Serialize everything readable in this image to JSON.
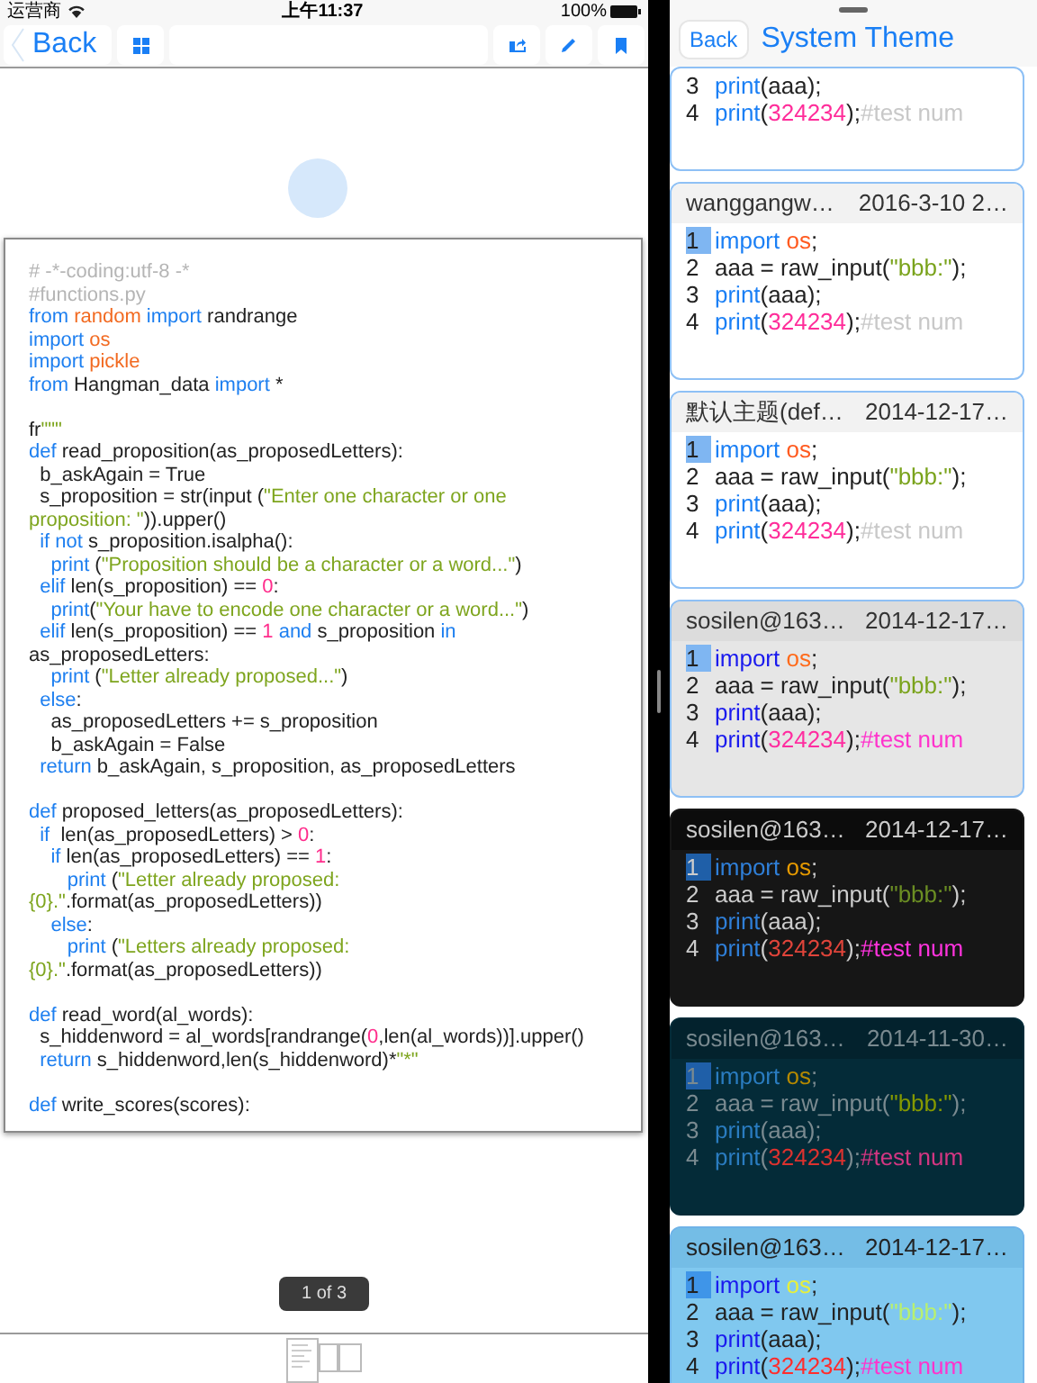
{
  "status_bar": {
    "carrier": "运营商",
    "time": "上午11:37",
    "battery": "100%"
  },
  "toolbar": {
    "back": "Back"
  },
  "document": {
    "page_indicator": "1 of 3",
    "lines": [
      {
        "kind": "code",
        "tokens": [
          {
            "kind": "comment",
            "text": "# -*-coding:utf-8 -*"
          }
        ]
      },
      {
        "kind": "code",
        "tokens": [
          {
            "kind": "comment",
            "text": "#functions.py"
          }
        ]
      },
      {
        "kind": "code",
        "tokens": [
          {
            "kind": "kw",
            "text": "from "
          },
          {
            "kind": "mod",
            "text": "random"
          },
          {
            "kind": "kw",
            "text": " import"
          },
          {
            "kind": "plain",
            "text": " randrange"
          }
        ]
      },
      {
        "kind": "code",
        "tokens": [
          {
            "kind": "kw",
            "text": "import "
          },
          {
            "kind": "mod",
            "text": "os"
          }
        ]
      },
      {
        "kind": "code",
        "tokens": [
          {
            "kind": "kw",
            "text": "import "
          },
          {
            "kind": "mod",
            "text": "pickle"
          }
        ]
      },
      {
        "kind": "code",
        "tokens": [
          {
            "kind": "kw",
            "text": "from"
          },
          {
            "kind": "plain",
            "text": " Hangman_data "
          },
          {
            "kind": "kw",
            "text": "import"
          },
          {
            "kind": "plain",
            "text": " *"
          }
        ]
      },
      {
        "kind": "blank"
      },
      {
        "kind": "code",
        "tokens": [
          {
            "kind": "plain",
            "text": "fr"
          },
          {
            "kind": "str",
            "text": "\"\"\""
          }
        ]
      },
      {
        "kind": "code",
        "tokens": [
          {
            "kind": "kw",
            "text": "def"
          },
          {
            "kind": "plain",
            "text": " read_proposition(as_proposedLetters):"
          }
        ]
      },
      {
        "kind": "code",
        "tokens": [
          {
            "kind": "plain",
            "text": "  b_askAgain = True"
          }
        ]
      },
      {
        "kind": "code",
        "tokens": [
          {
            "kind": "plain",
            "text": "  s_proposition = str(input ("
          },
          {
            "kind": "str",
            "text": "\"Enter one character or one"
          }
        ]
      },
      {
        "kind": "code",
        "tokens": [
          {
            "kind": "str",
            "text": "proposition: \""
          },
          {
            "kind": "plain",
            "text": ")).upper()"
          }
        ]
      },
      {
        "kind": "code",
        "tokens": [
          {
            "kind": "kw",
            "text": "  if not"
          },
          {
            "kind": "plain",
            "text": " s_proposition.isalpha():"
          }
        ]
      },
      {
        "kind": "code",
        "tokens": [
          {
            "kind": "kw",
            "text": "    print"
          },
          {
            "kind": "plain",
            "text": " ("
          },
          {
            "kind": "str",
            "text": "\"Proposition should be a character or a word...\""
          },
          {
            "kind": "plain",
            "text": ")"
          }
        ]
      },
      {
        "kind": "code",
        "tokens": [
          {
            "kind": "kw",
            "text": "  elif"
          },
          {
            "kind": "plain",
            "text": " len(s_proposition) == "
          },
          {
            "kind": "num",
            "text": "0"
          },
          {
            "kind": "plain",
            "text": ":"
          }
        ]
      },
      {
        "kind": "code",
        "tokens": [
          {
            "kind": "kw",
            "text": "    print"
          },
          {
            "kind": "plain",
            "text": "("
          },
          {
            "kind": "str",
            "text": "\"Your have to encode one character or a word...\""
          },
          {
            "kind": "plain",
            "text": ")"
          }
        ]
      },
      {
        "kind": "code",
        "tokens": [
          {
            "kind": "kw",
            "text": "  elif"
          },
          {
            "kind": "plain",
            "text": " len(s_proposition) == "
          },
          {
            "kind": "num",
            "text": "1"
          },
          {
            "kind": "kw",
            "text": " and"
          },
          {
            "kind": "plain",
            "text": " s_proposition "
          },
          {
            "kind": "kw",
            "text": "in"
          }
        ]
      },
      {
        "kind": "code",
        "tokens": [
          {
            "kind": "plain",
            "text": "as_proposedLetters:"
          }
        ]
      },
      {
        "kind": "code",
        "tokens": [
          {
            "kind": "kw",
            "text": "    print"
          },
          {
            "kind": "plain",
            "text": " ("
          },
          {
            "kind": "str",
            "text": "\"Letter already proposed...\""
          },
          {
            "kind": "plain",
            "text": ")"
          }
        ]
      },
      {
        "kind": "code",
        "tokens": [
          {
            "kind": "kw",
            "text": "  else"
          },
          {
            "kind": "plain",
            "text": ":"
          }
        ]
      },
      {
        "kind": "code",
        "tokens": [
          {
            "kind": "plain",
            "text": "    as_proposedLetters += s_proposition"
          }
        ]
      },
      {
        "kind": "code",
        "tokens": [
          {
            "kind": "plain",
            "text": "    b_askAgain = False"
          }
        ]
      },
      {
        "kind": "code",
        "tokens": [
          {
            "kind": "kw",
            "text": "  return"
          },
          {
            "kind": "plain",
            "text": " b_askAgain, s_proposition, as_proposedLetters"
          }
        ]
      },
      {
        "kind": "blank"
      },
      {
        "kind": "code",
        "tokens": [
          {
            "kind": "kw",
            "text": "def"
          },
          {
            "kind": "plain",
            "text": " proposed_letters(as_proposedLetters):"
          }
        ]
      },
      {
        "kind": "code",
        "tokens": [
          {
            "kind": "kw",
            "text": "  if"
          },
          {
            "kind": "plain",
            "text": "  len(as_proposedLetters) > "
          },
          {
            "kind": "num",
            "text": "0"
          },
          {
            "kind": "plain",
            "text": ":"
          }
        ]
      },
      {
        "kind": "code",
        "tokens": [
          {
            "kind": "kw",
            "text": "    if"
          },
          {
            "kind": "plain",
            "text": " len(as_proposedLetters) == "
          },
          {
            "kind": "num",
            "text": "1"
          },
          {
            "kind": "plain",
            "text": ":"
          }
        ]
      },
      {
        "kind": "code",
        "tokens": [
          {
            "kind": "kw",
            "text": "       print"
          },
          {
            "kind": "plain",
            "text": " ("
          },
          {
            "kind": "str",
            "text": "\"Letter already proposed:"
          }
        ]
      },
      {
        "kind": "code",
        "tokens": [
          {
            "kind": "str",
            "text": "{0}.\""
          },
          {
            "kind": "plain",
            "text": ".format(as_proposedLetters))"
          }
        ]
      },
      {
        "kind": "code",
        "tokens": [
          {
            "kind": "kw",
            "text": "    else"
          },
          {
            "kind": "plain",
            "text": ":"
          }
        ]
      },
      {
        "kind": "code",
        "tokens": [
          {
            "kind": "kw",
            "text": "       print"
          },
          {
            "kind": "plain",
            "text": " ("
          },
          {
            "kind": "str",
            "text": "\"Letters already proposed:"
          }
        ]
      },
      {
        "kind": "code",
        "tokens": [
          {
            "kind": "str",
            "text": "{0}.\""
          },
          {
            "kind": "plain",
            "text": ".format(as_proposedLetters))"
          }
        ]
      },
      {
        "kind": "blank"
      },
      {
        "kind": "code",
        "tokens": [
          {
            "kind": "kw",
            "text": "def"
          },
          {
            "kind": "plain",
            "text": " read_word(al_words):"
          }
        ]
      },
      {
        "kind": "code",
        "tokens": [
          {
            "kind": "plain",
            "text": "  s_hiddenword = al_words[randrange("
          },
          {
            "kind": "num",
            "text": "0"
          },
          {
            "kind": "plain",
            "text": ",len(al_words))].upper()"
          }
        ]
      },
      {
        "kind": "code",
        "tokens": [
          {
            "kind": "kw",
            "text": "  return"
          },
          {
            "kind": "plain",
            "text": " s_hiddenword,len(s_hiddenword)*"
          },
          {
            "kind": "str",
            "text": "\"*\""
          }
        ]
      },
      {
        "kind": "blank"
      },
      {
        "kind": "code",
        "tokens": [
          {
            "kind": "kw",
            "text": "def"
          },
          {
            "kind": "plain",
            "text": " write_scores(scores):"
          }
        ]
      }
    ]
  },
  "theme_panel": {
    "back": "Back",
    "title": "System Theme",
    "themes": [
      {
        "kind": "light",
        "lines": [
          {
            "number": "3",
            "selected": false,
            "tokens": [
              {
                "kind": "kw",
                "text": "print"
              },
              {
                "kind": "plain",
                "text": "(aaa);"
              }
            ]
          },
          {
            "number": "4",
            "selected": false,
            "tokens": [
              {
                "kind": "kw",
                "text": "print"
              },
              {
                "kind": "plain",
                "text": "("
              },
              {
                "kind": "num",
                "text": "324234"
              },
              {
                "kind": "plain",
                "text": ");"
              },
              {
                "kind": "comment",
                "text": "#test num"
              }
            ]
          }
        ]
      },
      {
        "kind": "light",
        "name": "wanggangw…",
        "date": "2016-3-10 2…",
        "lines": [
          {
            "number": "1",
            "selected": true,
            "tokens": [
              {
                "kind": "kw",
                "text": "import "
              },
              {
                "kind": "mod",
                "text": "os"
              },
              {
                "kind": "plain",
                "text": ";"
              }
            ]
          },
          {
            "number": "2",
            "selected": false,
            "tokens": [
              {
                "kind": "plain",
                "text": "aaa = raw_input("
              },
              {
                "kind": "str",
                "text": "\"bbb:\""
              },
              {
                "kind": "plain",
                "text": ");"
              }
            ]
          },
          {
            "number": "3",
            "selected": false,
            "tokens": [
              {
                "kind": "kw",
                "text": "print"
              },
              {
                "kind": "plain",
                "text": "(aaa);"
              }
            ]
          },
          {
            "number": "4",
            "selected": false,
            "tokens": [
              {
                "kind": "kw",
                "text": "print"
              },
              {
                "kind": "plain",
                "text": "("
              },
              {
                "kind": "num",
                "text": "324234"
              },
              {
                "kind": "plain",
                "text": ");"
              },
              {
                "kind": "comment",
                "text": "#test num"
              }
            ]
          }
        ]
      },
      {
        "kind": "light",
        "name": "默认主题(def…",
        "date": "2014-12-17…",
        "lines": [
          {
            "number": "1",
            "selected": true,
            "tokens": [
              {
                "kind": "kw",
                "text": "import "
              },
              {
                "kind": "mod",
                "text": "os"
              },
              {
                "kind": "plain",
                "text": ";"
              }
            ]
          },
          {
            "number": "2",
            "selected": false,
            "tokens": [
              {
                "kind": "plain",
                "text": "aaa = raw_input("
              },
              {
                "kind": "str",
                "text": "\"bbb:\""
              },
              {
                "kind": "plain",
                "text": ");"
              }
            ]
          },
          {
            "number": "3",
            "selected": false,
            "tokens": [
              {
                "kind": "kw",
                "text": "print"
              },
              {
                "kind": "plain",
                "text": "(aaa);"
              }
            ]
          },
          {
            "number": "4",
            "selected": false,
            "tokens": [
              {
                "kind": "kw",
                "text": "print"
              },
              {
                "kind": "plain",
                "text": "("
              },
              {
                "kind": "num",
                "text": "324234"
              },
              {
                "kind": "plain",
                "text": ");"
              },
              {
                "kind": "comment",
                "text": "#test num"
              }
            ]
          }
        ]
      },
      {
        "kind": "gray",
        "name": "sosilen@163…",
        "date": "2014-12-17…",
        "lines": [
          {
            "number": "1",
            "selected": true,
            "tokens": [
              {
                "kind": "kw",
                "text": "import "
              },
              {
                "kind": "mod",
                "text": "os"
              },
              {
                "kind": "plain",
                "text": ";"
              }
            ]
          },
          {
            "number": "2",
            "selected": false,
            "tokens": [
              {
                "kind": "plain",
                "text": "aaa = raw_input("
              },
              {
                "kind": "str",
                "text": "\"bbb:\""
              },
              {
                "kind": "plain",
                "text": ");"
              }
            ]
          },
          {
            "number": "3",
            "selected": false,
            "tokens": [
              {
                "kind": "kw",
                "text": "print"
              },
              {
                "kind": "plain",
                "text": "(aaa);"
              }
            ]
          },
          {
            "number": "4",
            "selected": false,
            "tokens": [
              {
                "kind": "kw",
                "text": "print"
              },
              {
                "kind": "plain",
                "text": "("
              },
              {
                "kind": "num",
                "text": "324234"
              },
              {
                "kind": "plain",
                "text": ");"
              },
              {
                "kind": "comment",
                "text": "#test num"
              }
            ]
          }
        ]
      },
      {
        "kind": "dark",
        "name": "sosilen@163…",
        "date": "2014-12-17…",
        "lines": [
          {
            "number": "1",
            "selected": true,
            "tokens": [
              {
                "kind": "kw",
                "text": "import "
              },
              {
                "kind": "mod",
                "text": "os"
              },
              {
                "kind": "plain",
                "text": ";"
              }
            ]
          },
          {
            "number": "2",
            "selected": false,
            "tokens": [
              {
                "kind": "plain",
                "text": "aaa = raw_input("
              },
              {
                "kind": "str",
                "text": "\"bbb:\""
              },
              {
                "kind": "plain",
                "text": ");"
              }
            ]
          },
          {
            "number": "3",
            "selected": false,
            "tokens": [
              {
                "kind": "kw",
                "text": "print"
              },
              {
                "kind": "plain",
                "text": "(aaa);"
              }
            ]
          },
          {
            "number": "4",
            "selected": false,
            "tokens": [
              {
                "kind": "kw",
                "text": "print"
              },
              {
                "kind": "plain",
                "text": "("
              },
              {
                "kind": "num",
                "text": "324234"
              },
              {
                "kind": "plain",
                "text": ");"
              },
              {
                "kind": "comment",
                "text": "#test num"
              }
            ]
          }
        ]
      },
      {
        "kind": "navy",
        "name": "sosilen@163…",
        "date": "2014-11-30…",
        "lines": [
          {
            "number": "1",
            "selected": true,
            "tokens": [
              {
                "kind": "kw",
                "text": "import "
              },
              {
                "kind": "mod",
                "text": "os"
              },
              {
                "kind": "plain",
                "text": ";"
              }
            ]
          },
          {
            "number": "2",
            "selected": false,
            "tokens": [
              {
                "kind": "plain",
                "text": "aaa = raw_input("
              },
              {
                "kind": "str",
                "text": "\"bbb:\""
              },
              {
                "kind": "plain",
                "text": ");"
              }
            ]
          },
          {
            "number": "3",
            "selected": false,
            "tokens": [
              {
                "kind": "kw",
                "text": "print"
              },
              {
                "kind": "plain",
                "text": "(aaa);"
              }
            ]
          },
          {
            "number": "4",
            "selected": false,
            "tokens": [
              {
                "kind": "kw",
                "text": "print"
              },
              {
                "kind": "plain",
                "text": "("
              },
              {
                "kind": "num",
                "text": "324234"
              },
              {
                "kind": "plain",
                "text": ");"
              },
              {
                "kind": "comment",
                "text": "#test num"
              }
            ]
          }
        ]
      },
      {
        "kind": "sky",
        "name": "sosilen@163…",
        "date": "2014-12-17…",
        "lines": [
          {
            "number": "1",
            "selected": true,
            "tokens": [
              {
                "kind": "kw",
                "text": "import "
              },
              {
                "kind": "mod",
                "text": "os"
              },
              {
                "kind": "plain",
                "text": ";"
              }
            ]
          },
          {
            "number": "2",
            "selected": false,
            "tokens": [
              {
                "kind": "plain",
                "text": "aaa = raw_input("
              },
              {
                "kind": "str",
                "text": "\"bbb:\""
              },
              {
                "kind": "plain",
                "text": ");"
              }
            ]
          },
          {
            "number": "3",
            "selected": false,
            "tokens": [
              {
                "kind": "kw",
                "text": "print"
              },
              {
                "kind": "plain",
                "text": "(aaa);"
              }
            ]
          },
          {
            "number": "4",
            "selected": false,
            "tokens": [
              {
                "kind": "kw",
                "text": "print"
              },
              {
                "kind": "plain",
                "text": "("
              },
              {
                "kind": "num",
                "text": "324234"
              },
              {
                "kind": "plain",
                "text": ");"
              },
              {
                "kind": "comment",
                "text": "#test num"
              }
            ]
          }
        ]
      }
    ]
  }
}
